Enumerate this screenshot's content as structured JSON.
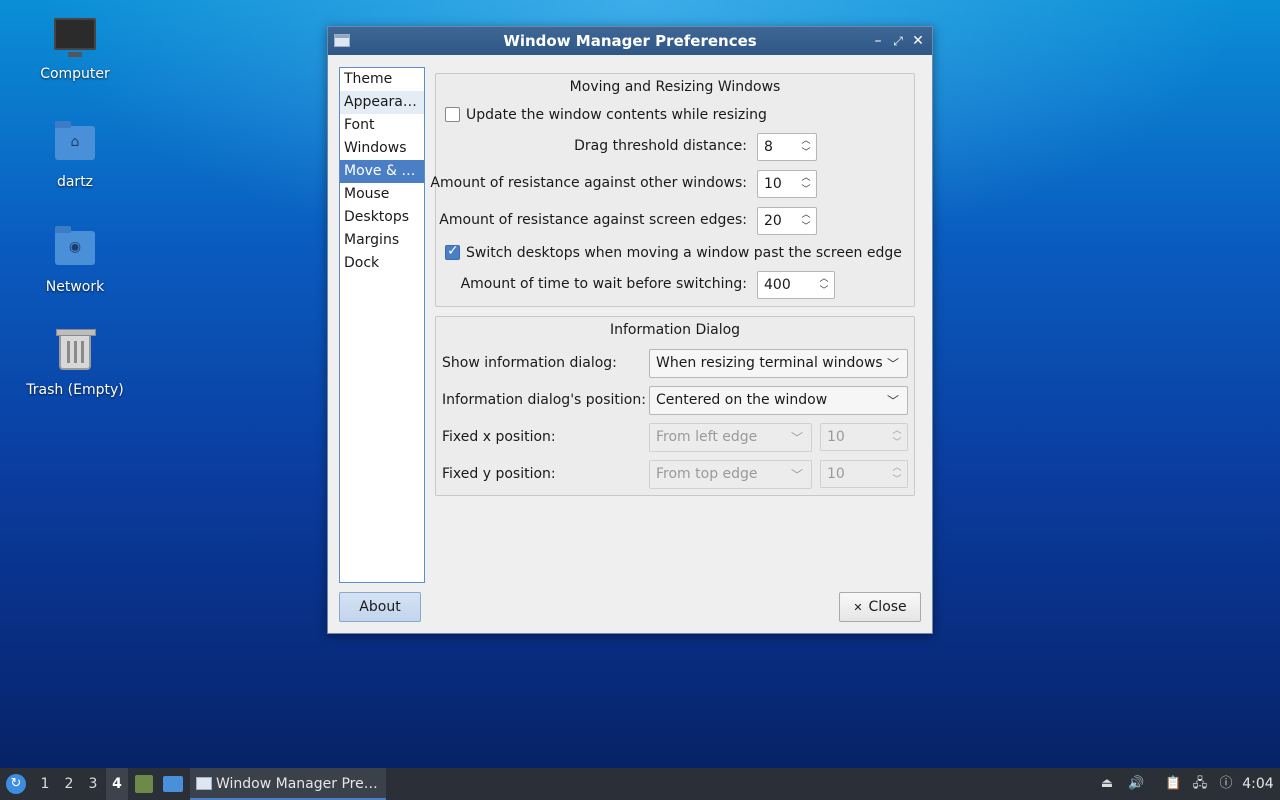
{
  "desktop": {
    "icons": [
      {
        "label": "Computer",
        "icon": "computer-icon"
      },
      {
        "label": "dartz",
        "icon": "home-folder-icon"
      },
      {
        "label": "Network",
        "icon": "network-folder-icon"
      },
      {
        "label": "Trash (Empty)",
        "icon": "trash-icon"
      }
    ]
  },
  "window": {
    "title": "Window Manager Preferences",
    "controls": {
      "minimize": "–",
      "maximize": "⤢",
      "close": "✕"
    },
    "sidebar": {
      "items": [
        "Theme",
        "Appearance",
        "Font",
        "Windows",
        "Move & Resize",
        "Mouse",
        "Desktops",
        "Margins",
        "Dock"
      ],
      "display": [
        "Theme",
        "Appeara…",
        "Font",
        "Windows",
        "Move & …",
        "Mouse",
        "Desktops",
        "Margins",
        "Dock"
      ],
      "selected": "Move & Resize"
    },
    "moving_group": {
      "title": "Moving and Resizing Windows",
      "update_contents": {
        "label": "Update the window contents while resizing",
        "checked": false
      },
      "drag_threshold": {
        "label": "Drag threshold distance:",
        "value": "8"
      },
      "resist_windows": {
        "label": "Amount of resistance against other windows:",
        "value": "10"
      },
      "resist_edges": {
        "label": "Amount of resistance against screen edges:",
        "value": "20"
      },
      "switch_desktops": {
        "label": "Switch desktops when moving a window past the screen edge",
        "checked": true
      },
      "wait_time": {
        "label": "Amount of time to wait before switching:",
        "value": "400"
      }
    },
    "info_group": {
      "title": "Information Dialog",
      "show_dialog": {
        "label": "Show information dialog:",
        "value": "When resizing terminal windows"
      },
      "dialog_position": {
        "label": "Information dialog's position:",
        "value": "Centered on the window"
      },
      "fixed_x": {
        "label": "Fixed x position:",
        "edge": "From left edge",
        "value": "10"
      },
      "fixed_y": {
        "label": "Fixed y position:",
        "edge": "From top edge",
        "value": "10"
      }
    },
    "buttons": {
      "about": "About",
      "close": "Close",
      "close_icon": "✕"
    }
  },
  "taskbar": {
    "workspaces": [
      "1",
      "2",
      "3",
      "4"
    ],
    "active_workspace": "4",
    "task_label": "Window Manager Pre…",
    "clock": "4:04",
    "tray": [
      "eject-icon",
      "volume-icon",
      "clipboard-icon",
      "network-icon",
      "notification-icon"
    ]
  },
  "colors": {
    "accent": "#4a7fc5",
    "titlebar": "#2f5786",
    "taskbar": "#2b3038"
  }
}
